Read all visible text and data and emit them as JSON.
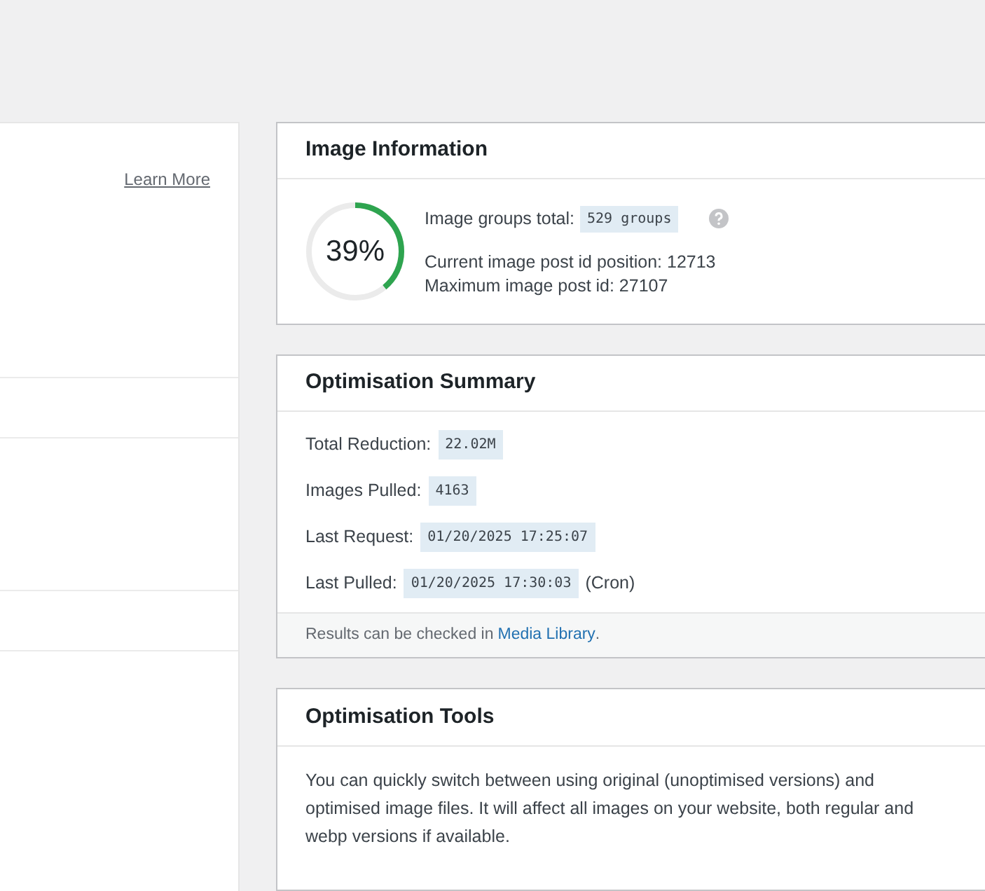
{
  "left_panel": {
    "learn_more_link": "Learn More"
  },
  "image_information": {
    "title": "Image Information",
    "progress": {
      "level": 0.39,
      "label": "39%"
    },
    "groups_label": "Image groups total:",
    "groups_value": "529 groups",
    "current_position": "Current image post id position: 12713",
    "maximum_id": "Maximum image post id: 27107"
  },
  "optimisation_summary": {
    "title": "Optimisation Summary",
    "rows": [
      {
        "label": "Total Reduction:",
        "value": "22.02M"
      },
      {
        "label": "Images Pulled:",
        "value": "4163"
      },
      {
        "label": "Last Request:",
        "value": "01/20/2025 17:25:07"
      },
      {
        "label": "Last Pulled:",
        "value": "01/20/2025 17:30:03",
        "suffix": "(Cron)"
      }
    ],
    "footer_text": "Results can be checked in",
    "footer_link": "Media Library",
    "footer_end": "."
  },
  "optimisation_tools": {
    "title": "Optimisation Tools",
    "description": "You can quickly switch between using original (unoptimised versions) and optimised image files. It will affect all images on your website, both regular and webp versions if available."
  }
}
